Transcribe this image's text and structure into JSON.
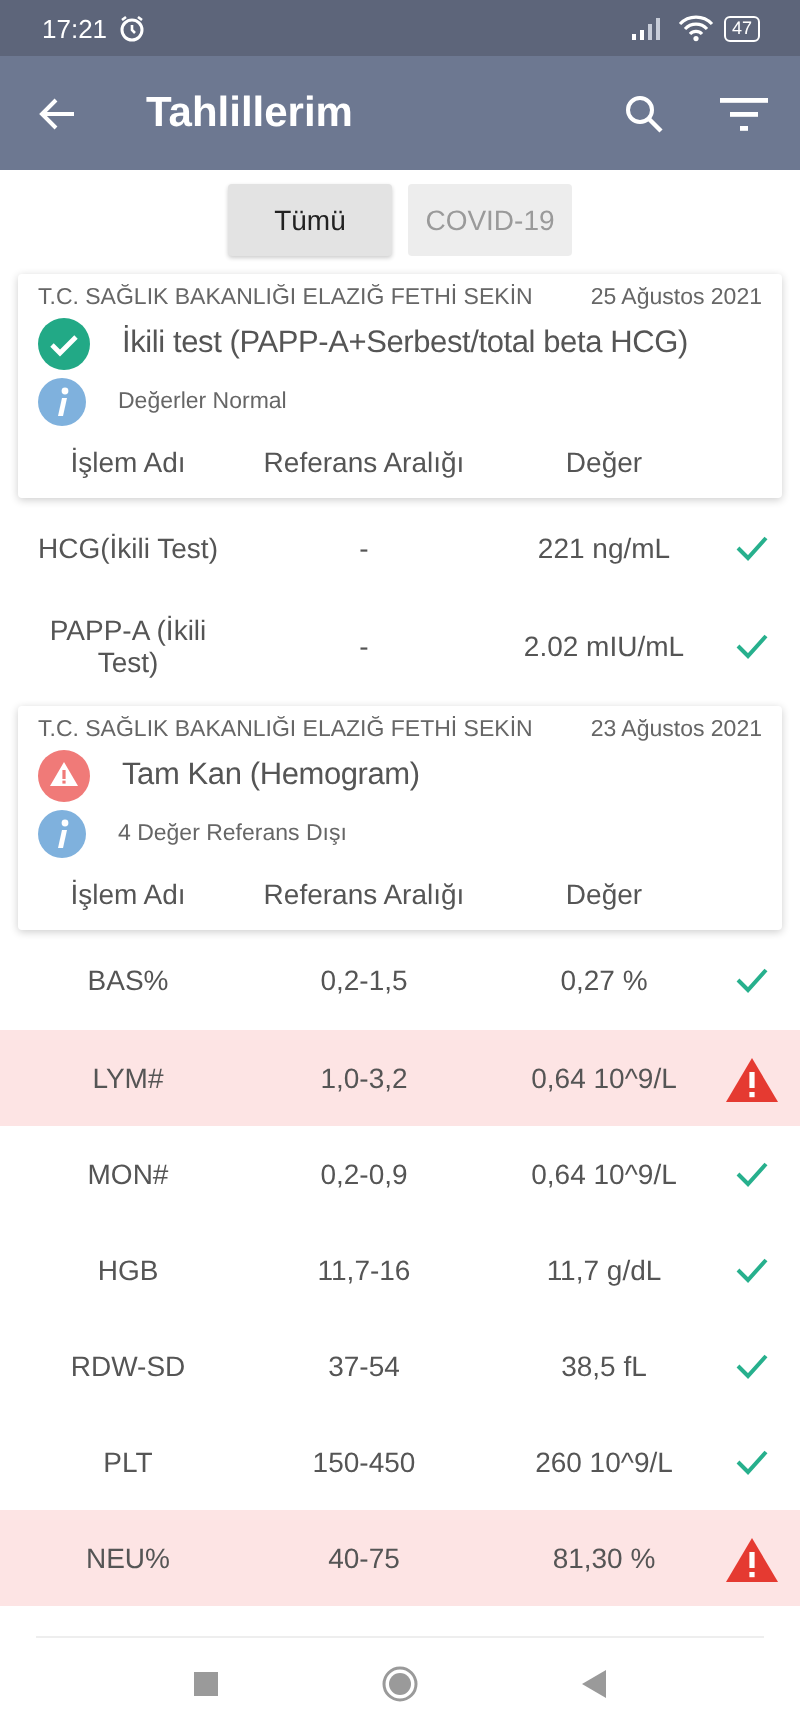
{
  "status_bar": {
    "time": "17:21",
    "battery": "47"
  },
  "app_bar": {
    "title": "Tahlillerim"
  },
  "filters": [
    {
      "label": "Tümü",
      "selected": true
    },
    {
      "label": "COVID-19",
      "selected": false
    }
  ],
  "results": [
    {
      "institution": "T.C. SAĞLIK BAKANLIĞI ELAZIĞ FETHİ SEKİN",
      "date": "25 Ağustos 2021",
      "test": "İkili test (PAPP-A+Serbest/total beta HCG)",
      "out_of_range": false,
      "summary": "Değerler Normal",
      "columns": [
        "İşlem Adı",
        "Referans Aralığı",
        "Değer"
      ],
      "rows": [
        {
          "name": "HCG(İkili Test)",
          "range": "-",
          "value": "221 ng/mL",
          "out_of_range": false
        },
        {
          "name": "PAPP-A (İkili Test)",
          "range": "-",
          "value": "2.02 mIU/mL",
          "out_of_range": false
        }
      ]
    },
    {
      "institution": "T.C. SAĞLIK BAKANLIĞI ELAZIĞ FETHİ SEKİN",
      "date": "23 Ağustos 2021",
      "test": "Tam Kan (Hemogram)",
      "out_of_range": true,
      "summary": "4 Değer Referans Dışı",
      "columns": [
        "İşlem Adı",
        "Referans Aralığı",
        "Değer"
      ],
      "rows": [
        {
          "name": "BAS%",
          "range": "0,2-1,5",
          "value": "0,27 %",
          "out_of_range": false
        },
        {
          "name": "LYM#",
          "range": "1,0-3,2",
          "value": "0,64 10^9/L",
          "out_of_range": true
        },
        {
          "name": "MON#",
          "range": "0,2-0,9",
          "value": "0,64 10^9/L",
          "out_of_range": false
        },
        {
          "name": "HGB",
          "range": "11,7-16",
          "value": "11,7 g/dL",
          "out_of_range": false
        },
        {
          "name": "RDW-SD",
          "range": "37-54",
          "value": "38,5 fL",
          "out_of_range": false
        },
        {
          "name": "PLT",
          "range": "150-450",
          "value": "260 10^9/L",
          "out_of_range": false
        },
        {
          "name": "NEU%",
          "range": "40-75",
          "value": "81,30 %",
          "out_of_range": true
        }
      ]
    }
  ]
}
